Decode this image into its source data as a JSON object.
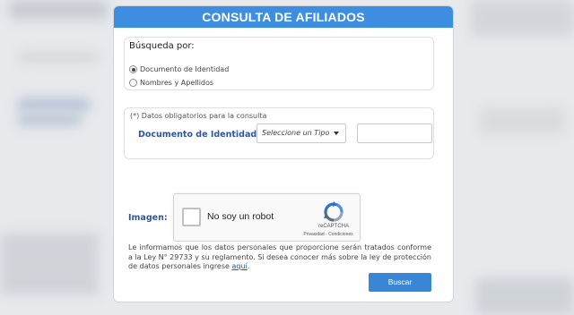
{
  "header": {
    "title": "CONSULTA DE AFILIADOS"
  },
  "search": {
    "label": "Búsqueda por:",
    "options": [
      {
        "label": "Documento de Identidad",
        "checked": true
      },
      {
        "label": "Nombres y Apellidos",
        "checked": false
      }
    ]
  },
  "required": {
    "note": "(*) Datos obligatorios para la consulta",
    "doc_label": "Documento de Identidad:",
    "tipo_select": "Seleccione un Tipo",
    "doc_number_value": ""
  },
  "captcha": {
    "label": "Imagen:",
    "checkbox_text": "No soy un robot",
    "brand": "reCAPTCHA",
    "terms": "Privacidad - Condiciones"
  },
  "legal": {
    "text": "Le informamos que los datos personales que proporcione serán tratados conforme a la Ley N° 29733 y su reglamento. Si desea conocer más sobre la ley de protección de datos personales ingrese ",
    "link_text": "aquí",
    "end": "."
  },
  "actions": {
    "search_button": "Buscar"
  },
  "colors": {
    "header_bg": "#3d8ee0",
    "label_blue": "#2f56a0",
    "button_bg": "#3a86d6",
    "page_bg": "#e7e9ec"
  }
}
